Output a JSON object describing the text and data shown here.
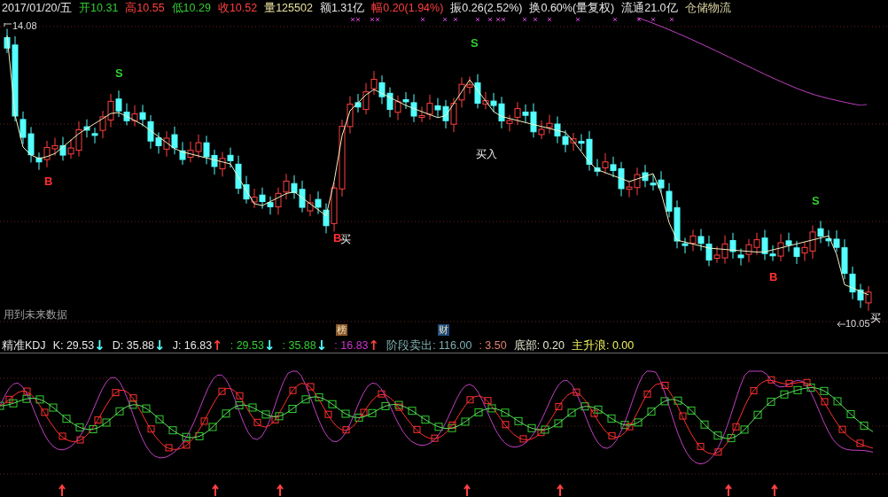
{
  "header": {
    "date": "2017/01/20/五",
    "fields": [
      {
        "label": "开",
        "value": "10.31",
        "color": "#33cc33"
      },
      {
        "label": "高",
        "value": "10.55",
        "color": "#ff4040"
      },
      {
        "label": "低",
        "value": "10.29",
        "color": "#33cc33"
      },
      {
        "label": "收",
        "value": "10.52",
        "color": "#ff4040"
      },
      {
        "label": "量",
        "value": "125502",
        "color": "#e8e0a0"
      },
      {
        "label": "额",
        "value": "1.31亿",
        "color": "#e6e6e6"
      },
      {
        "label": "幅",
        "value": "0.20(1.94%)",
        "color": "#ff4040"
      },
      {
        "label": "振",
        "value": "0.26(2.52%)",
        "color": "#e6e6e6"
      },
      {
        "label": "换",
        "value": "0.60%(量复权)",
        "color": "#e6e6e6"
      },
      {
        "label": "流通",
        "value": "21.0亿",
        "color": "#e6e6e6"
      }
    ],
    "sector": "仓储物流"
  },
  "main_chart": {
    "high_label": "14.08",
    "low_label": "10.05",
    "signals": [
      {
        "text": "B",
        "kind": "buy"
      },
      {
        "text": "S",
        "kind": "sell"
      },
      {
        "text": "B",
        "kind": "buy"
      },
      {
        "text": "买",
        "kind": "note"
      },
      {
        "text": "S",
        "kind": "sell"
      },
      {
        "text": "买入",
        "kind": "note"
      },
      {
        "text": "B",
        "kind": "buy"
      },
      {
        "text": "S",
        "kind": "sell"
      },
      {
        "text": "买",
        "kind": "note"
      }
    ],
    "notice": "用到未来数据",
    "tags": [
      {
        "text": "榜",
        "color": "#8a5a2a"
      },
      {
        "text": "财",
        "color": "#1e4a7a"
      }
    ]
  },
  "indicator": {
    "items": [
      {
        "text": "精准KDJ",
        "color": "#e6e6e6"
      },
      {
        "text": "K: 29.53",
        "color": "#e6e6e6",
        "arrow": {
          "text": "↓",
          "color": "#54ffff"
        }
      },
      {
        "text": "D: 35.88",
        "color": "#e6e6e6",
        "arrow": {
          "text": "↓",
          "color": "#54ffff"
        }
      },
      {
        "text": "J: 16.83",
        "color": "#e6e6e6",
        "arrow": {
          "text": "↑",
          "color": "#ff4040"
        }
      },
      {
        "text": ": 29.53",
        "color": "#33cc33",
        "arrow": {
          "text": "↓",
          "color": "#54ffff"
        }
      },
      {
        "text": ": 35.88",
        "color": "#33cc33",
        "arrow": {
          "text": "↓",
          "color": "#54ffff"
        }
      },
      {
        "text": ": 16.83",
        "color": "#cc33cc",
        "arrow": {
          "text": "↑",
          "color": "#ff4040"
        }
      },
      {
        "text": "阶段卖出: 116.00",
        "color": "#7fb0b0"
      },
      {
        "text": ": 3.50",
        "color": "#e08070"
      },
      {
        "text": "底部: 0.20",
        "color": "#e6e6d0"
      },
      {
        "text": "主升浪: 0.00",
        "color": "#f0f060"
      }
    ]
  }
}
